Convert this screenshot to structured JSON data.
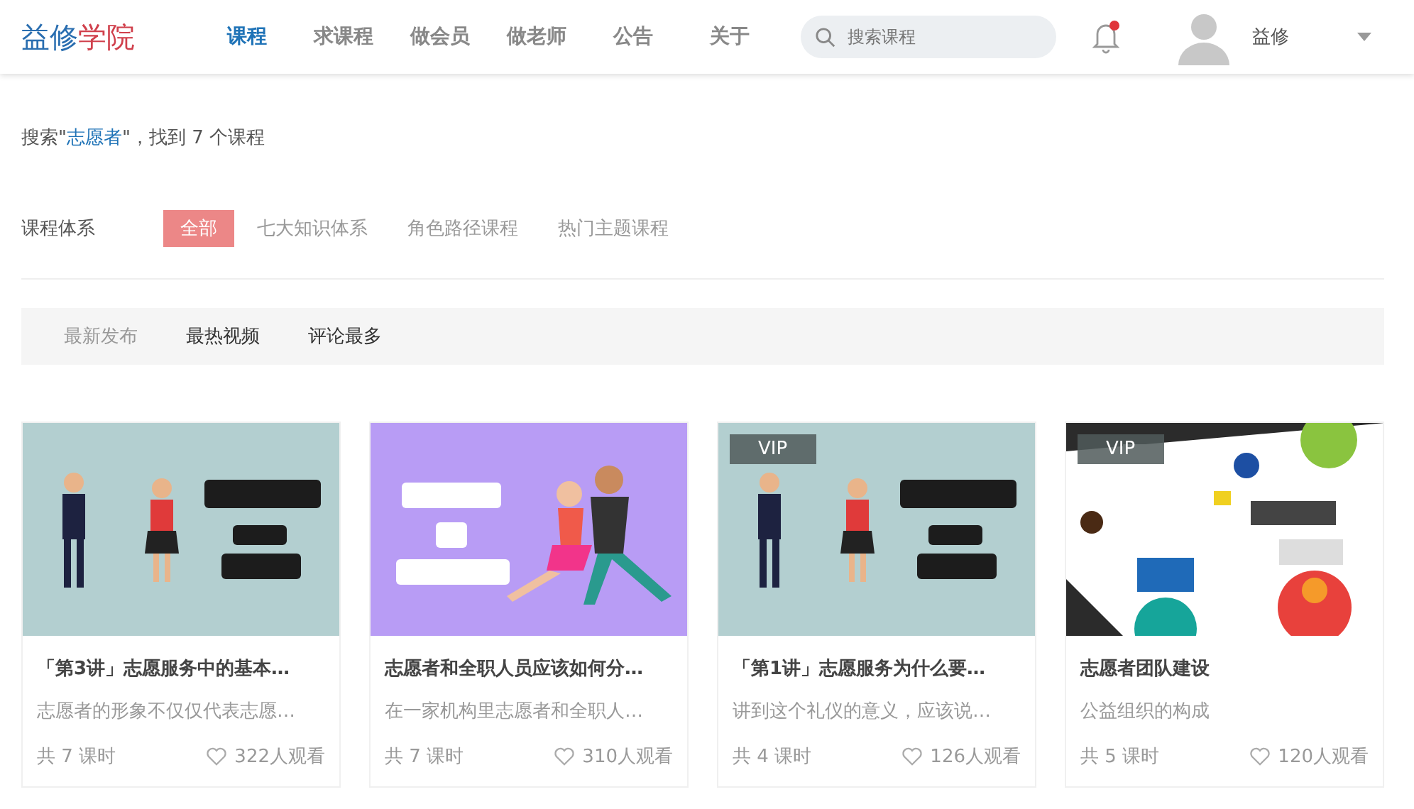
{
  "header": {
    "logo": {
      "part_1": "益修",
      "part_2": "学院"
    },
    "nav": [
      {
        "label": "课程",
        "selected": true
      },
      {
        "label": "求课程",
        "selected": false
      },
      {
        "label": "做会员",
        "selected": false
      },
      {
        "label": "做老师",
        "selected": false
      },
      {
        "label": "公告",
        "selected": false
      },
      {
        "label": "关于",
        "selected": false
      }
    ],
    "search": {
      "placeholder": "搜索课程"
    },
    "notifications": {
      "unread": true
    },
    "user": {
      "name": "益修"
    }
  },
  "search_summary": {
    "prefix": "搜索\"",
    "keyword": "志愿者",
    "suffix": "\"，找到 7 个课程"
  },
  "filter": {
    "label": "课程体系",
    "options": [
      {
        "label": "全部",
        "selected": true
      },
      {
        "label": "七大知识体系",
        "selected": false
      },
      {
        "label": "角色路径课程",
        "selected": false
      },
      {
        "label": "热门主题课程",
        "selected": false
      }
    ]
  },
  "sort_tabs": [
    {
      "label": "最新发布",
      "selected": true
    },
    {
      "label": "最热视频",
      "selected": false
    },
    {
      "label": "评论最多",
      "selected": false
    }
  ],
  "courses": [
    {
      "title": "「第3讲」志愿服务中的基本…",
      "description": "志愿者的形象不仅仅代表志愿…",
      "lessons": "共 7 课时",
      "views": "322人观看"
    },
    {
      "title": "志愿者和全职人员应该如何分…",
      "description": "在一家机构里志愿者和全职人…",
      "lessons": "共 7 课时",
      "views": "310人观看"
    },
    {
      "vip": "VIP",
      "title": "「第1讲」志愿服务为什么要…",
      "description": "讲到这个礼仪的意义，应该说…",
      "lessons": "共 4 课时",
      "views": "126人观看"
    },
    {
      "vip": "VIP",
      "title": "志愿者团队建设",
      "description": "公益组织的构成",
      "lessons": "共 5 课时",
      "views": "120人观看"
    }
  ]
}
